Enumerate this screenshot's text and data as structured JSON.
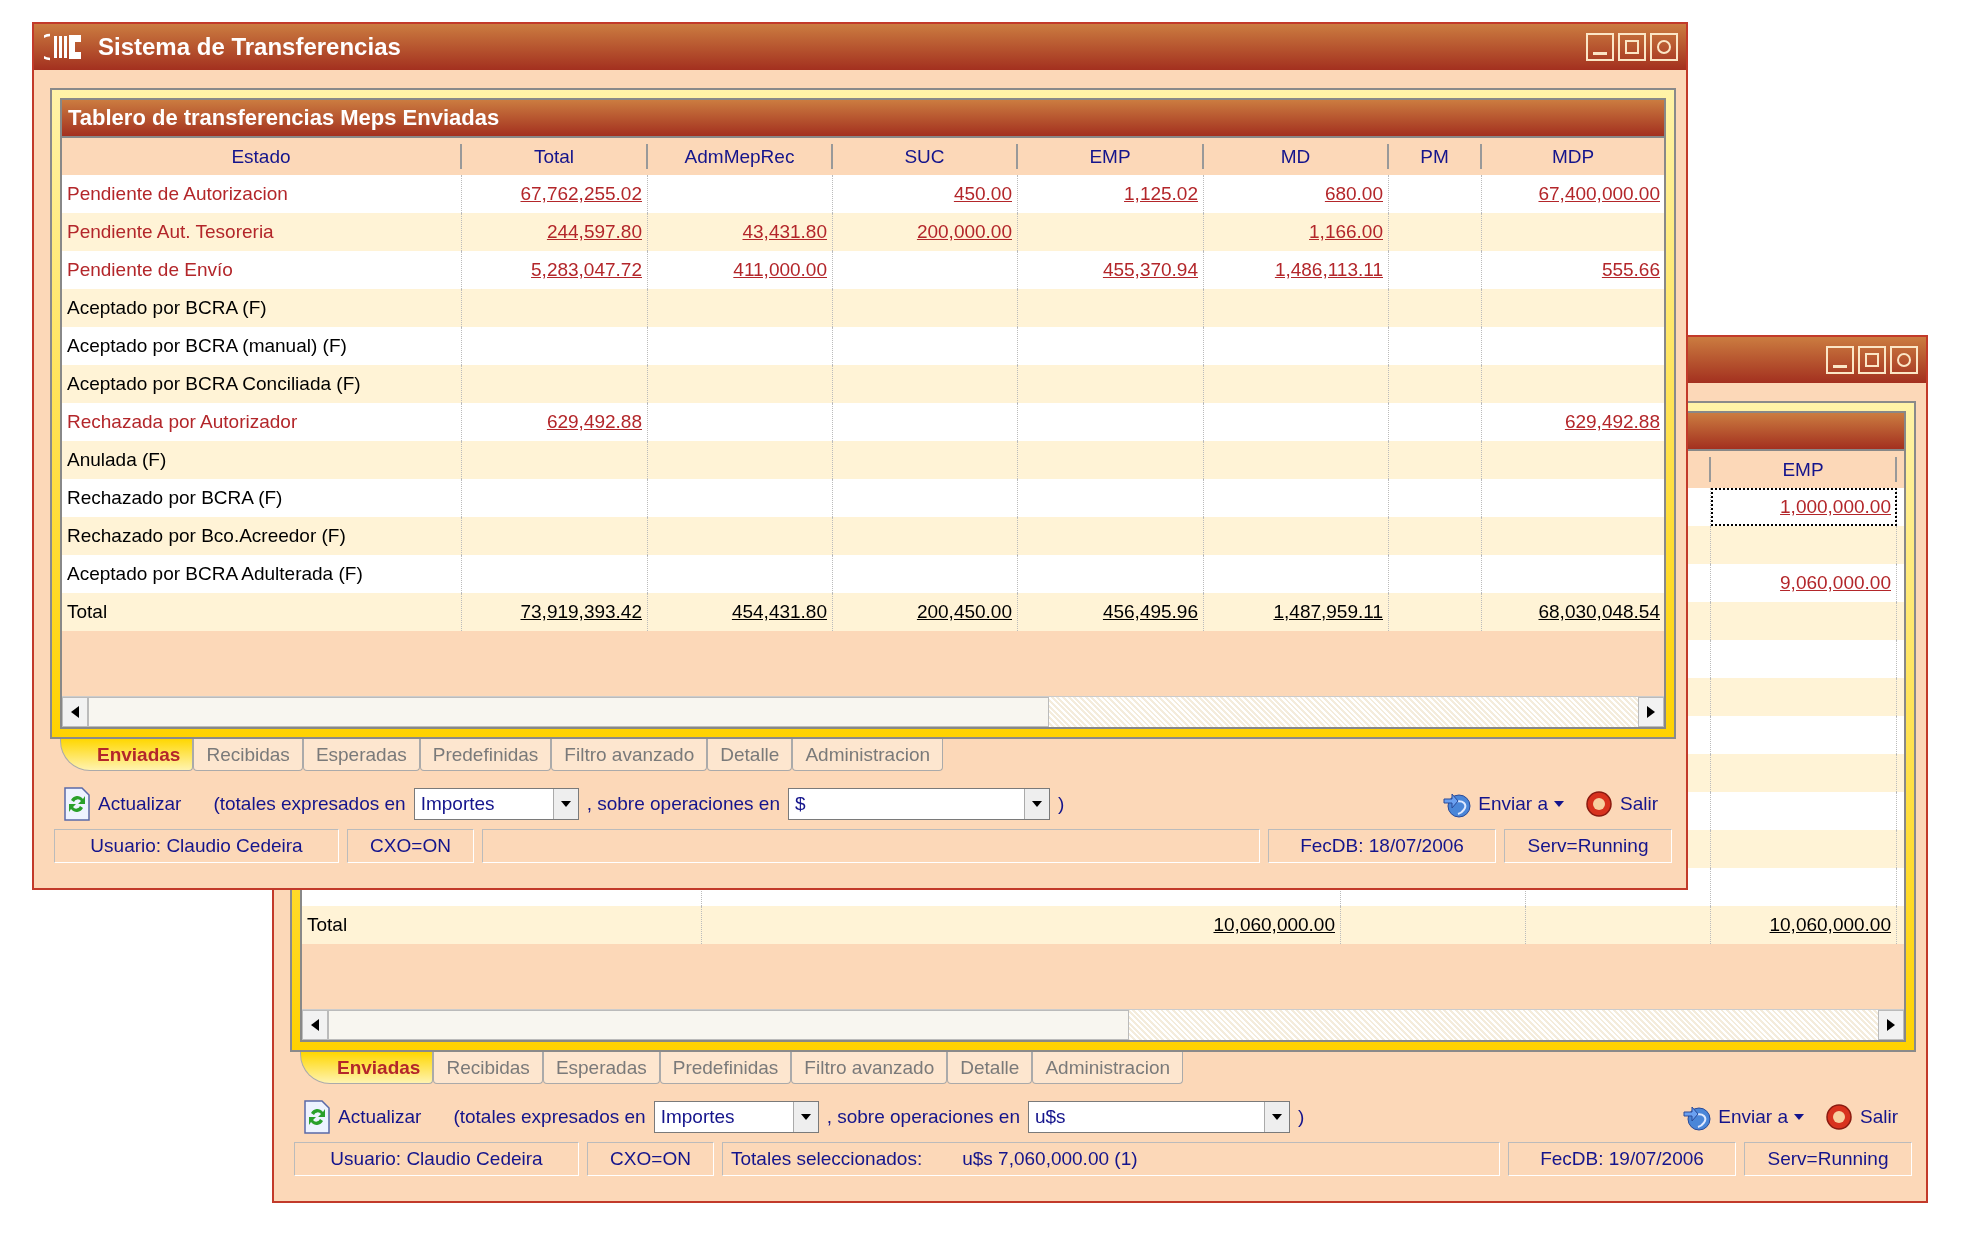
{
  "windows": [
    {
      "title": "Sistema de Transferencias",
      "panel_title": "Tablero de transferencias Meps Enviadas",
      "columns": [
        "Estado",
        "Total",
        "AdmMepRec",
        "SUC",
        "EMP",
        "MD",
        "PM",
        "MDP"
      ],
      "rows": [
        {
          "kind": "status",
          "label": "Pendiente de Autorizacion",
          "alert": true,
          "cells": [
            "67,762,255.02",
            null,
            "450.00",
            "1,125.02",
            "680.00",
            null,
            "67,400,000.00"
          ]
        },
        {
          "kind": "status",
          "label": "Pendiente Aut. Tesoreria",
          "alert": true,
          "cells": [
            "244,597.80",
            "43,431.80",
            "200,000.00",
            null,
            "1,166.00",
            null,
            null
          ]
        },
        {
          "kind": "status",
          "label": "Pendiente de Envío",
          "alert": true,
          "cells": [
            "5,283,047.72",
            "411,000.00",
            null,
            "455,370.94",
            "1,486,113.11",
            null,
            "555.66"
          ]
        },
        {
          "kind": "status",
          "label": "Aceptado por BCRA (F)",
          "alert": false
        },
        {
          "kind": "status",
          "label": "Aceptado por BCRA (manual) (F)",
          "alert": false
        },
        {
          "kind": "status",
          "label": "Aceptado por BCRA Conciliada (F)",
          "alert": false
        },
        {
          "kind": "status",
          "label": "Rechazada por Autorizador",
          "alert": true,
          "cells": [
            "629,492.88",
            null,
            null,
            null,
            null,
            null,
            "629,492.88"
          ]
        },
        {
          "kind": "status",
          "label": "Anulada (F)",
          "alert": false
        },
        {
          "kind": "status",
          "label": "Rechazado por BCRA (F)",
          "alert": false
        },
        {
          "kind": "status",
          "label": "Rechazado por Bco.Acreedor (F)",
          "alert": false
        },
        {
          "kind": "status",
          "label": "Aceptado por BCRA Adulterada (F)",
          "alert": false
        },
        {
          "kind": "total",
          "label": "Total",
          "cells": [
            "73,919,393.42",
            "454,431.80",
            "200,450.00",
            "456,495.96",
            "1,487,959.11",
            null,
            "68,030,048.54"
          ]
        }
      ],
      "tabs": [
        {
          "label": "Enviadas",
          "selected": true
        },
        {
          "label": "Recibidas",
          "selected": false
        },
        {
          "label": "Esperadas",
          "selected": false
        },
        {
          "label": "Predefinidas",
          "selected": false
        },
        {
          "label": "Filtro avanzado",
          "selected": false
        },
        {
          "label": "Detalle",
          "selected": false
        },
        {
          "label": "Administracion",
          "selected": false
        }
      ],
      "toolbar": {
        "refresh": "Actualizar",
        "totals_label": "(totales expresados en",
        "totals_value": "Importes",
        "operations_label": ", sobre operaciones en",
        "operations_value": "$",
        "close_paren": ")",
        "send": "Enviar a",
        "exit": "Salir"
      },
      "status_bar": {
        "user": "Usuario: Claudio Cedeira",
        "cxo": "CXO=ON",
        "fecdb": "FecDB: 18/07/2006",
        "server": "Serv=Running"
      }
    },
    {
      "columns": [
        null,
        null,
        null,
        null,
        "EMP"
      ],
      "rows": [
        {
          "kind": "status",
          "selected": true,
          "alert": true,
          "cells": [
            null,
            null,
            null,
            "1,000,000.00"
          ]
        },
        {
          "kind": "status",
          "selected": false
        },
        {
          "kind": "status",
          "selected": false,
          "alert": true,
          "cells": [
            null,
            null,
            null,
            "9,060,000.00"
          ]
        },
        {
          "kind": "status",
          "selected": false
        },
        {
          "kind": "status",
          "selected": false
        },
        {
          "kind": "status",
          "selected": false
        },
        {
          "kind": "status",
          "selected": false
        },
        {
          "kind": "status",
          "selected": false
        },
        {
          "kind": "status",
          "selected": false
        },
        {
          "kind": "status",
          "selected": false
        },
        {
          "kind": "status",
          "selected": false
        },
        {
          "kind": "total",
          "selected": false,
          "label": "Total",
          "cells": [
            "10,060,000.00",
            null,
            null,
            "10,060,000.00"
          ]
        }
      ],
      "tabs": [
        {
          "label": "Enviadas",
          "selected": true
        },
        {
          "label": "Recibidas",
          "selected": false
        },
        {
          "label": "Esperadas",
          "selected": false
        },
        {
          "label": "Predefinidas",
          "selected": false
        },
        {
          "label": "Filtro avanzado",
          "selected": false
        },
        {
          "label": "Detalle",
          "selected": false
        },
        {
          "label": "Administracion",
          "selected": false
        }
      ],
      "toolbar": {
        "refresh": "Actualizar",
        "totals_label": "(totales expresados en",
        "totals_value": "Importes",
        "operations_label": ", sobre operaciones en",
        "operations_value": "u$s",
        "close_paren": ")",
        "send": "Enviar a",
        "exit": "Salir"
      },
      "status_bar": {
        "user": "Usuario: Claudio Cedeira",
        "cxo": "CXO=ON",
        "selection_label": "Totales seleccionados:",
        "selection_value": "u$s 7,060,000.00 (1)",
        "fecdb": "FecDB: 19/07/2006",
        "server": "Serv=Running"
      }
    }
  ]
}
